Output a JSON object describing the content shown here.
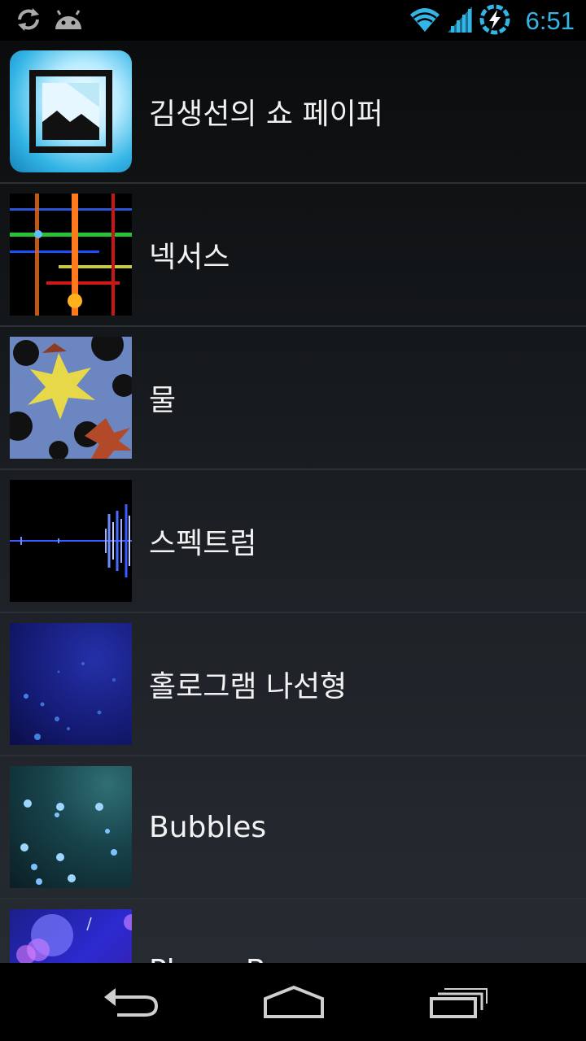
{
  "status_bar": {
    "time": "6:51",
    "left_icons": [
      "sync-icon",
      "android-icon"
    ],
    "right_icons": [
      "wifi-icon",
      "signal-icon",
      "battery-charging-icon"
    ]
  },
  "wallpapers": [
    {
      "label": "김생선의 쇼 페이퍼",
      "thumb": "photo-frame-thumbnail"
    },
    {
      "label": "넥서스",
      "thumb": "nexus-lines-thumbnail"
    },
    {
      "label": "물",
      "thumb": "maple-leaf-water-thumbnail"
    },
    {
      "label": "스펙트럼",
      "thumb": "spectrum-waveform-thumbnail"
    },
    {
      "label": "홀로그램 나선형",
      "thumb": "holo-spiral-thumbnail"
    },
    {
      "label": "Bubbles",
      "thumb": "bubbles-thumbnail"
    },
    {
      "label": "Phase Beam",
      "thumb": "phase-beam-thumbnail"
    }
  ],
  "nav_bar": {
    "buttons": [
      "back-icon",
      "home-icon",
      "recents-icon"
    ]
  },
  "colors": {
    "accent": "#33b5e5",
    "text": "#f2f2f2",
    "divider": "#2c2f33"
  }
}
